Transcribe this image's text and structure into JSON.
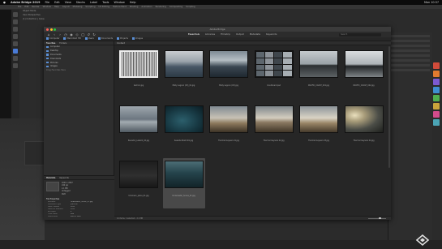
{
  "menubar": {
    "apple": "",
    "app_name": "Adobe Bridge 2019",
    "items": [
      "File",
      "Edit",
      "View",
      "Stacks",
      "Label",
      "Tools",
      "Window",
      "Help"
    ],
    "clock": "Mon 10:37"
  },
  "background_app": {
    "top_items": [
      "File",
      "Edit",
      "Render",
      "Window",
      "Help",
      "Layout",
      "Modeling",
      "Sculpting",
      "UV Editing",
      "Texture Paint",
      "Shading",
      "Animation",
      "Rendering",
      "Compositing",
      "Scripting"
    ],
    "header_lines": [
      "Object Mode",
      "User Perspective",
      "(1) Collection | Cube"
    ]
  },
  "bridge": {
    "window_title": "Adobe Bridge",
    "workspaces": [
      "Essentials",
      "Libraries",
      "Filmstrip",
      "Output",
      "Metadata",
      "Keywords"
    ],
    "active_workspace": "Essentials",
    "search_placeholder": "Search",
    "path": [
      "Computer",
      "Macintosh HD",
      "Users",
      "Documents",
      "Projects",
      "Images"
    ],
    "panels": {
      "favorites_tab": "Favorites",
      "folders_tab": "Folders",
      "content": "Content",
      "metadata_tab": "Metadata",
      "keywords_tab": "Keywords"
    },
    "favorites": [
      "Computer",
      "Desktop",
      "Documents",
      "Downloads",
      "Pictures",
      "Images",
      "Drag Favorites Here"
    ],
    "content_title": "Content",
    "thumbnails": [
      {
        "caption": "bw01-2.jpg",
        "fill": "i1"
      },
      {
        "caption": "Misty Lagoon (03)_01.jpg",
        "fill": "i2"
      },
      {
        "caption": "Misty Lagoon (03).jpg",
        "fill": "i3"
      },
      {
        "caption": "moodboard.psd",
        "fill": "grid"
      },
      {
        "caption": "PACIFIC_COAST_001.jpg",
        "fill": "i5"
      },
      {
        "caption": "PACIFIC_COAST_002.jpg",
        "fill": "i6"
      },
      {
        "caption": "Peaceful_Lake01_02.jpg",
        "fill": "i7"
      },
      {
        "caption": "Seaside Boat 001.jpg",
        "fill": "i8"
      },
      {
        "caption": "Thermal Geysers 01.jpg",
        "fill": "i9"
      },
      {
        "caption": "Thermal Geysers 02.jpg",
        "fill": "i10"
      },
      {
        "caption": "Thermal Geysers 03.jpg",
        "fill": "i11"
      },
      {
        "caption": "Thermal Geysers 04.jpg",
        "fill": "i12"
      },
      {
        "caption": "Unknown_place_01.jpg",
        "fill": "i13"
      },
      {
        "caption": "Underwater_Scene_01.jpg",
        "fill": "i14"
      }
    ],
    "selected_index": 13,
    "status": "14 items, 1 selected - 2.1 MB",
    "metadata": {
      "summary": [
        "4000 x 2667",
        "240 ppi",
        "2.1 MB",
        "Untagged",
        "RGB"
      ],
      "section": "File Properties",
      "rows": [
        {
          "k": "Filename",
          "v": "Underwater_Scene_01.jpg"
        },
        {
          "k": "Document Type",
          "v": "JPEG file"
        },
        {
          "k": "Date Created",
          "v": "2019"
        },
        {
          "k": "Date File Modified",
          "v": "2019"
        },
        {
          "k": "Bit Depth",
          "v": "8"
        },
        {
          "k": "Color Mode",
          "v": "RGB"
        },
        {
          "k": "Dimensions",
          "v": "4000 x 2667"
        }
      ]
    }
  },
  "colors": {
    "accent": "#4a7bd6",
    "traffic": [
      "#ff5f57",
      "#febc2e",
      "#28c840"
    ],
    "side_tabs": [
      "#d24b3a",
      "#e07a2f",
      "#7c5ad1",
      "#3e8ed0",
      "#4fae4f",
      "#c9a43b",
      "#d24b8c",
      "#4ba4b5"
    ]
  }
}
